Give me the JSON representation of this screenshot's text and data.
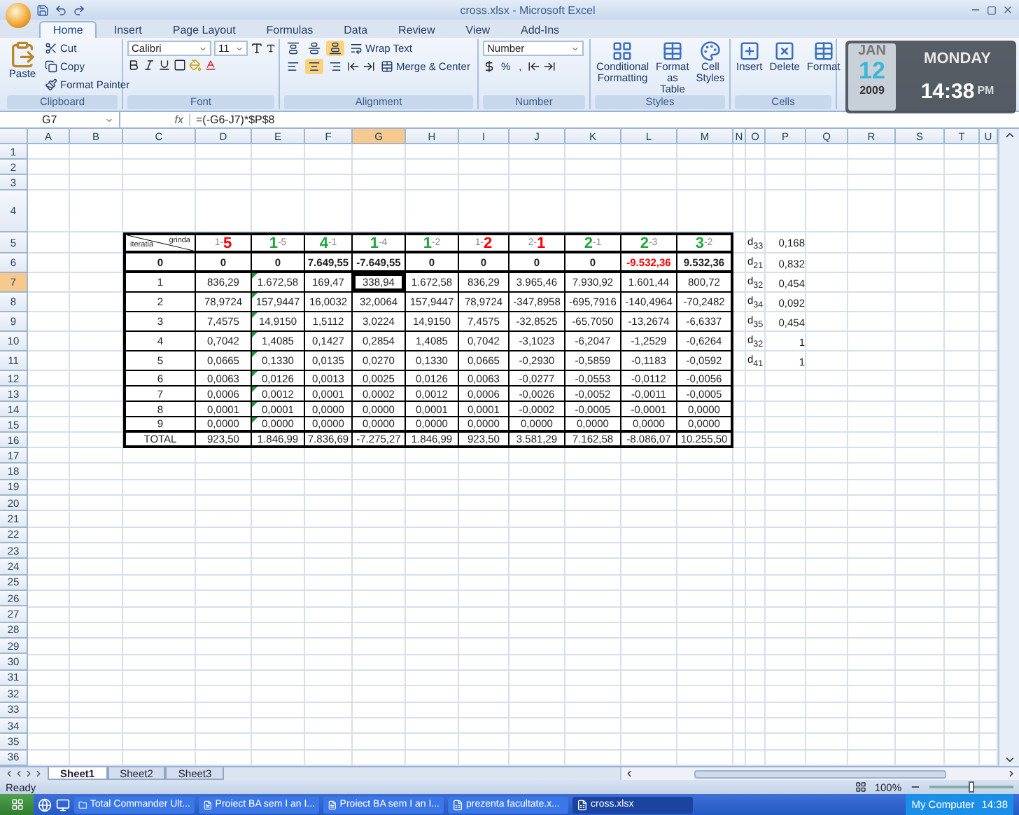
{
  "window": {
    "title": "cross.xlsx - Microsoft Excel"
  },
  "tabs": [
    {
      "label": "Home",
      "selected": true
    },
    {
      "label": "Insert",
      "selected": false
    },
    {
      "label": "Page Layout",
      "selected": false
    },
    {
      "label": "Formulas",
      "selected": false
    },
    {
      "label": "Data",
      "selected": false
    },
    {
      "label": "Review",
      "selected": false
    },
    {
      "label": "View",
      "selected": false
    },
    {
      "label": "Add-Ins",
      "selected": false
    }
  ],
  "ribbon": {
    "clipboard": {
      "label": "Clipboard",
      "paste": "Paste",
      "cut": "Cut",
      "copy": "Copy",
      "format_painter": "Format Painter"
    },
    "font": {
      "label": "Font",
      "name": "Calibri",
      "size": "11"
    },
    "alignment": {
      "label": "Alignment",
      "wrap": "Wrap Text",
      "merge": "Merge & Center",
      "vertical_align": [
        {
          "selected": false
        },
        {
          "selected": false
        },
        {
          "selected": true
        }
      ],
      "horizontal_align": [
        {
          "selected": false
        },
        {
          "selected": true
        },
        {
          "selected": false
        }
      ]
    },
    "number": {
      "label": "Number",
      "format": "Number",
      "percent": "%",
      "comma": ","
    },
    "styles": {
      "label": "Styles",
      "buttons": [
        "Conditional Formatting",
        "Format as Table",
        "Cell Styles"
      ]
    },
    "cells": {
      "label": "Cells",
      "buttons": [
        "Insert",
        "Delete",
        "Format"
      ]
    }
  },
  "gadget": {
    "month": "JAN",
    "day": "12",
    "year": "2009",
    "weekday": "MONDAY",
    "time": "14:38",
    "meridiem": "PM"
  },
  "formula_bar": {
    "name_box": "G7",
    "function_label": "fx",
    "formula": "=(-G6-J7)*$P$8"
  },
  "columns": [
    {
      "label": "A",
      "selected": false
    },
    {
      "label": "B",
      "selected": false
    },
    {
      "label": "C",
      "selected": false
    },
    {
      "label": "D",
      "selected": false
    },
    {
      "label": "E",
      "selected": false
    },
    {
      "label": "F",
      "selected": false
    },
    {
      "label": "G",
      "selected": true
    },
    {
      "label": "H",
      "selected": false
    },
    {
      "label": "I",
      "selected": false
    },
    {
      "label": "J",
      "selected": false
    },
    {
      "label": "K",
      "selected": false
    },
    {
      "label": "L",
      "selected": false
    },
    {
      "label": "M",
      "selected": false
    },
    {
      "label": "N",
      "selected": false
    },
    {
      "label": "O",
      "selected": false
    },
    {
      "label": "P",
      "selected": false
    },
    {
      "label": "Q",
      "selected": false
    },
    {
      "label": "R",
      "selected": false
    },
    {
      "label": "S",
      "selected": false
    },
    {
      "label": "T",
      "selected": false
    },
    {
      "label": "U",
      "selected": false
    }
  ],
  "row_headers": [
    {
      "label": "1",
      "selected": false
    },
    {
      "label": "2",
      "selected": false
    },
    {
      "label": "3",
      "selected": false
    },
    {
      "label": "4",
      "selected": false
    },
    {
      "label": "5",
      "selected": false
    },
    {
      "label": "6",
      "selected": false
    },
    {
      "label": "7",
      "selected": true
    },
    {
      "label": "8",
      "selected": false
    },
    {
      "label": "9",
      "selected": false
    },
    {
      "label": "10",
      "selected": false
    },
    {
      "label": "11",
      "selected": false
    },
    {
      "label": "12",
      "selected": false
    },
    {
      "label": "13",
      "selected": false
    },
    {
      "label": "14",
      "selected": false
    },
    {
      "label": "15",
      "selected": false
    },
    {
      "label": "16",
      "selected": false
    },
    {
      "label": "17",
      "selected": false
    },
    {
      "label": "18",
      "selected": false
    },
    {
      "label": "19",
      "selected": false
    },
    {
      "label": "20",
      "selected": false
    },
    {
      "label": "21",
      "selected": false
    },
    {
      "label": "22",
      "selected": false
    },
    {
      "label": "23",
      "selected": false
    },
    {
      "label": "24",
      "selected": false
    },
    {
      "label": "25",
      "selected": false
    },
    {
      "label": "26",
      "selected": false
    },
    {
      "label": "27",
      "selected": false
    },
    {
      "label": "28",
      "selected": false
    },
    {
      "label": "29",
      "selected": false
    },
    {
      "label": "30",
      "selected": false
    },
    {
      "label": "31",
      "selected": false
    },
    {
      "label": "32",
      "selected": false
    },
    {
      "label": "33",
      "selected": false
    },
    {
      "label": "34",
      "selected": false
    },
    {
      "label": "35",
      "selected": false
    },
    {
      "label": "36",
      "selected": false
    }
  ],
  "table": {
    "corner_top": "grinda",
    "corner_bottom": "iteratia",
    "headers": [
      [
        {
          "text": "1-",
          "emphasis": false
        },
        {
          "text": "5",
          "emphasis": true,
          "color": "#ff0000"
        }
      ],
      [
        {
          "text": "1",
          "emphasis": true,
          "color": "#1fa83c"
        },
        {
          "text": "-5",
          "emphasis": false
        }
      ],
      [
        {
          "text": "4",
          "emphasis": true,
          "color": "#1fa83c"
        },
        {
          "text": "-1",
          "emphasis": false
        }
      ],
      [
        {
          "text": "1",
          "emphasis": true,
          "color": "#1fa83c"
        },
        {
          "text": "-4",
          "emphasis": false
        }
      ],
      [
        {
          "text": "1",
          "emphasis": true,
          "color": "#1fa83c"
        },
        {
          "text": "-2",
          "emphasis": false
        }
      ],
      [
        {
          "text": "1-",
          "emphasis": false
        },
        {
          "text": "2",
          "emphasis": true,
          "color": "#ff0000"
        }
      ],
      [
        {
          "text": "2-",
          "emphasis": false
        },
        {
          "text": "1",
          "emphasis": true,
          "color": "#ff0000"
        }
      ],
      [
        {
          "text": "2",
          "emphasis": true,
          "color": "#1fa83c"
        },
        {
          "text": "-1",
          "emphasis": false
        }
      ],
      [
        {
          "text": "2",
          "emphasis": true,
          "color": "#1fa83c"
        },
        {
          "text": "-3",
          "emphasis": false
        }
      ],
      [
        {
          "text": "3",
          "emphasis": true,
          "color": "#1fa83c"
        },
        {
          "text": "-2",
          "emphasis": false
        }
      ]
    ],
    "rows": [
      {
        "label": "0",
        "bold": true,
        "error_mark": false,
        "values": [
          {
            "text": "0"
          },
          {
            "text": "0"
          },
          {
            "text": "7.649,55"
          },
          {
            "text": "-7.649,55"
          },
          {
            "text": "0"
          },
          {
            "text": "0"
          },
          {
            "text": "0"
          },
          {
            "text": "0"
          },
          {
            "text": "-9.532,36",
            "color": "#ff0000"
          },
          {
            "text": "9.532,36"
          }
        ]
      },
      {
        "label": "1",
        "bold": false,
        "error_mark": true,
        "values": [
          "836,29",
          "1.672,58",
          "169,47",
          "338,94",
          "1.672,58",
          "836,29",
          "3.965,46",
          "7.930,92",
          "1.601,44",
          "800,72"
        ]
      },
      {
        "label": "2",
        "bold": false,
        "error_mark": true,
        "values": [
          "78,9724",
          "157,9447",
          "16,0032",
          "32,0064",
          "157,9447",
          "78,9724",
          "-347,8958",
          "-695,7916",
          "-140,4964",
          "-70,2482"
        ]
      },
      {
        "label": "3",
        "bold": false,
        "error_mark": true,
        "values": [
          "7,4575",
          "14,9150",
          "1,5112",
          "3,0224",
          "14,9150",
          "7,4575",
          "-32,8525",
          "-65,7050",
          "-13,2674",
          "-6,6337"
        ]
      },
      {
        "label": "4",
        "bold": false,
        "error_mark": true,
        "values": [
          "0,7042",
          "1,4085",
          "0,1427",
          "0,2854",
          "1,4085",
          "0,7042",
          "-3,1023",
          "-6,2047",
          "-1,2529",
          "-0,6264"
        ]
      },
      {
        "label": "5",
        "bold": false,
        "error_mark": true,
        "values": [
          "0,0665",
          "0,1330",
          "0,0135",
          "0,0270",
          "0,1330",
          "0,0665",
          "-0,2930",
          "-0,5859",
          "-0,1183",
          "-0,0592"
        ]
      },
      {
        "label": "6",
        "bold": false,
        "error_mark": true,
        "values": [
          "0,0063",
          "0,0126",
          "0,0013",
          "0,0025",
          "0,0126",
          "0,0063",
          "-0,0277",
          "-0,0553",
          "-0,0112",
          "-0,0056"
        ]
      },
      {
        "label": "7",
        "bold": false,
        "error_mark": true,
        "values": [
          "0,0006",
          "0,0012",
          "0,0001",
          "0,0002",
          "0,0012",
          "0,0006",
          "-0,0026",
          "-0,0052",
          "-0,0011",
          "-0,0005"
        ]
      },
      {
        "label": "8",
        "bold": false,
        "error_mark": true,
        "values": [
          "0,0001",
          "0,0001",
          "0,0000",
          "0,0000",
          "0,0001",
          "0,0001",
          "-0,0002",
          "-0,0005",
          "-0,0001",
          "0,0000"
        ]
      },
      {
        "label": "9",
        "bold": false,
        "error_mark": true,
        "values": [
          "0,0000",
          "0,0000",
          "0,0000",
          "0,0000",
          "0,0000",
          "0,0000",
          "0,0000",
          "0,0000",
          "0,0000",
          "0,0000"
        ]
      },
      {
        "label": "TOTAL",
        "bold": false,
        "error_mark": false,
        "values": [
          "923,50",
          "1.846,99",
          "7.836,69",
          "-7.275,27",
          "1.846,99",
          "923,50",
          "3.581,29",
          "7.162,58",
          "-8.086,07",
          "10.255,50"
        ]
      }
    ]
  },
  "side_values": [
    {
      "label": "d$_{33}$",
      "value": "0,168"
    },
    {
      "label": "d$_{21}$",
      "value": "0,832"
    },
    {
      "label": "d$_{32}$",
      "value": "0,454"
    },
    {
      "label": "d$_{34}$",
      "value": "0,092"
    },
    {
      "label": "d$_{35}$",
      "value": "0,454"
    },
    {
      "label": "d$_{32}$",
      "value": "1"
    },
    {
      "label": "d$_{41}$",
      "value": "1"
    }
  ],
  "sheet_tabs": [
    {
      "label": "Sheet1",
      "selected": true
    },
    {
      "label": "Sheet2",
      "selected": false
    },
    {
      "label": "Sheet3",
      "selected": false
    }
  ],
  "status_bar": {
    "state": "Ready",
    "zoom": "100%",
    "zoom_slider": {
      "level": 0.5
    }
  },
  "taskbar": {
    "items": [
      {
        "label": "Total Commander Ult...",
        "kind": "folder",
        "selected": false
      },
      {
        "label": "Proiect BA sem I an I...",
        "kind": "document",
        "selected": false
      },
      {
        "label": "Proiect BA sem I an I...",
        "kind": "document",
        "selected": false
      },
      {
        "label": "prezenta facultate.x...",
        "kind": "sheet",
        "selected": false
      },
      {
        "label": "cross.xlsx",
        "kind": "sheet",
        "selected": true
      }
    ],
    "tray_label": "My Computer",
    "clock": "14:38"
  }
}
